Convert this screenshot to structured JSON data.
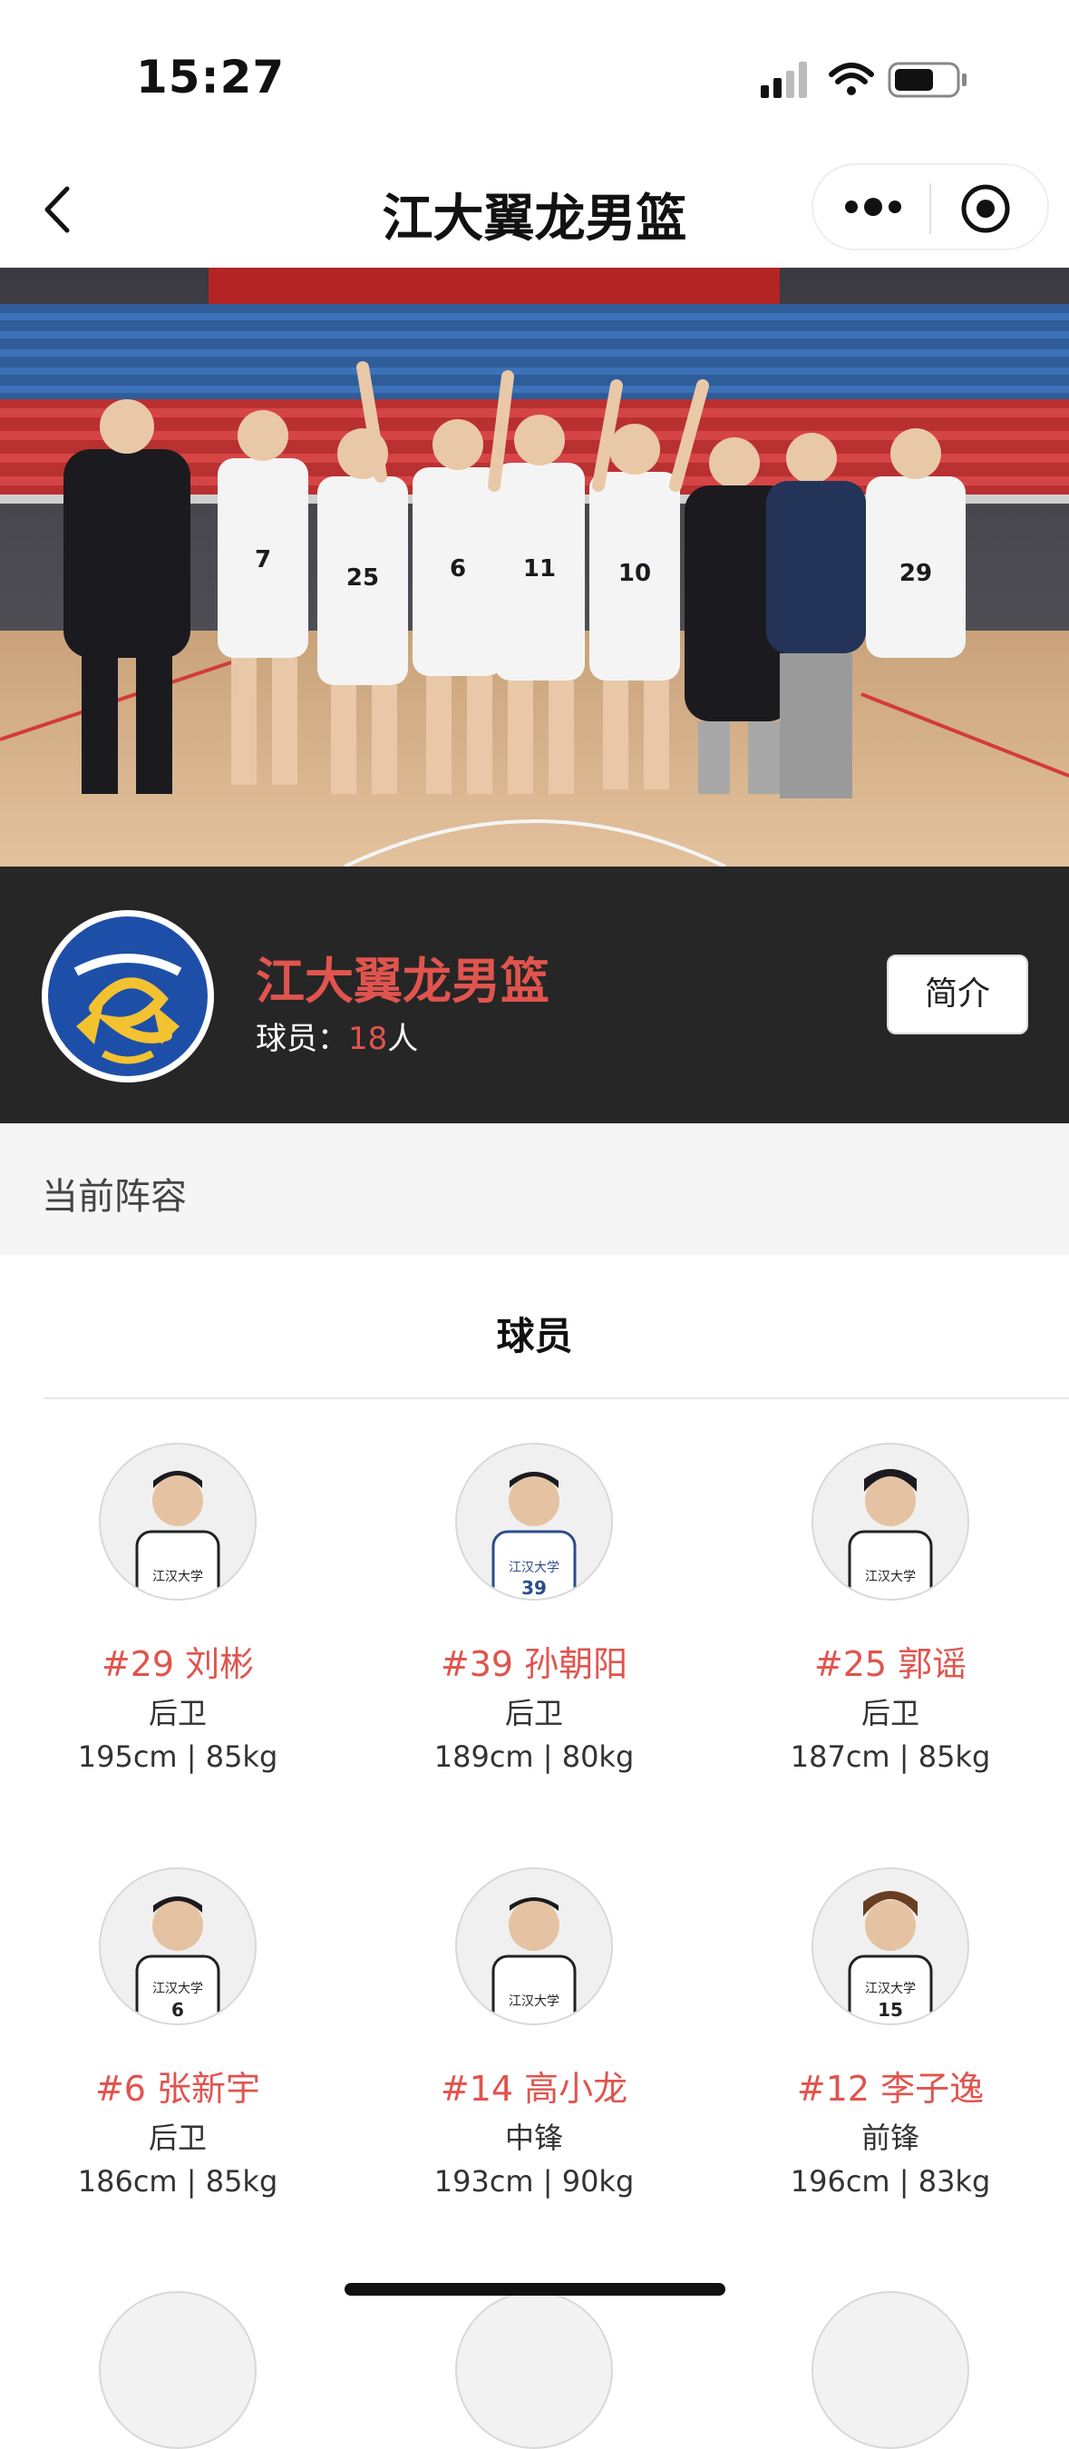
{
  "status_bar": {
    "time": "15:27"
  },
  "nav": {
    "title": "江大翼龙男篮"
  },
  "team": {
    "name": "江大翼龙男篮",
    "count_label": "球员：",
    "count_value": "18",
    "count_unit": "人",
    "intro_button": "简介"
  },
  "section": {
    "label": "当前阵容"
  },
  "tab": {
    "label": "球员"
  },
  "players": [
    {
      "name": "#29 刘彬",
      "position": "后卫",
      "body": "195cm | 85kg"
    },
    {
      "name": "#39 孙朝阳",
      "position": "后卫",
      "body": "189cm | 80kg"
    },
    {
      "name": "#25 郭谣",
      "position": "后卫",
      "body": "187cm | 85kg"
    },
    {
      "name": "#6 张新宇",
      "position": "后卫",
      "body": "186cm | 85kg"
    },
    {
      "name": "#14 高小龙",
      "position": "中锋",
      "body": "193cm | 90kg"
    },
    {
      "name": "#12 李子逸",
      "position": "前锋",
      "body": "196cm | 83kg"
    }
  ],
  "colors": {
    "accent": "#e0544e",
    "header_bg": "#262626",
    "section_bg": "#f5f5f5",
    "logo_blue": "#1e4fa8",
    "logo_gold": "#f2c230"
  }
}
